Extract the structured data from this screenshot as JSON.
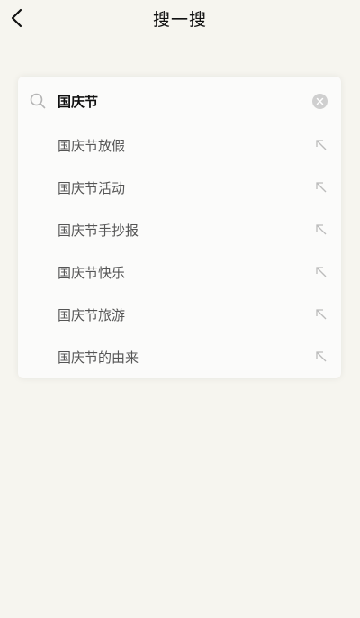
{
  "header": {
    "title": "搜一搜",
    "back_icon": "chevron-left-icon"
  },
  "search": {
    "value": "国庆节",
    "search_icon": "search-icon",
    "clear_icon": "clear-icon"
  },
  "suggestions": [
    {
      "label": "国庆节放假",
      "icon": "arrow-up-left-icon"
    },
    {
      "label": "国庆节活动",
      "icon": "arrow-up-left-icon"
    },
    {
      "label": "国庆节手抄报",
      "icon": "arrow-up-left-icon"
    },
    {
      "label": "国庆节快乐",
      "icon": "arrow-up-left-icon"
    },
    {
      "label": "国庆节旅游",
      "icon": "arrow-up-left-icon"
    },
    {
      "label": "国庆节的由来",
      "icon": "arrow-up-left-icon"
    }
  ],
  "colors": {
    "background": "#f6f5ef",
    "card": "#fbfbfa",
    "text": "#555555",
    "icon": "#bbbbbb"
  }
}
